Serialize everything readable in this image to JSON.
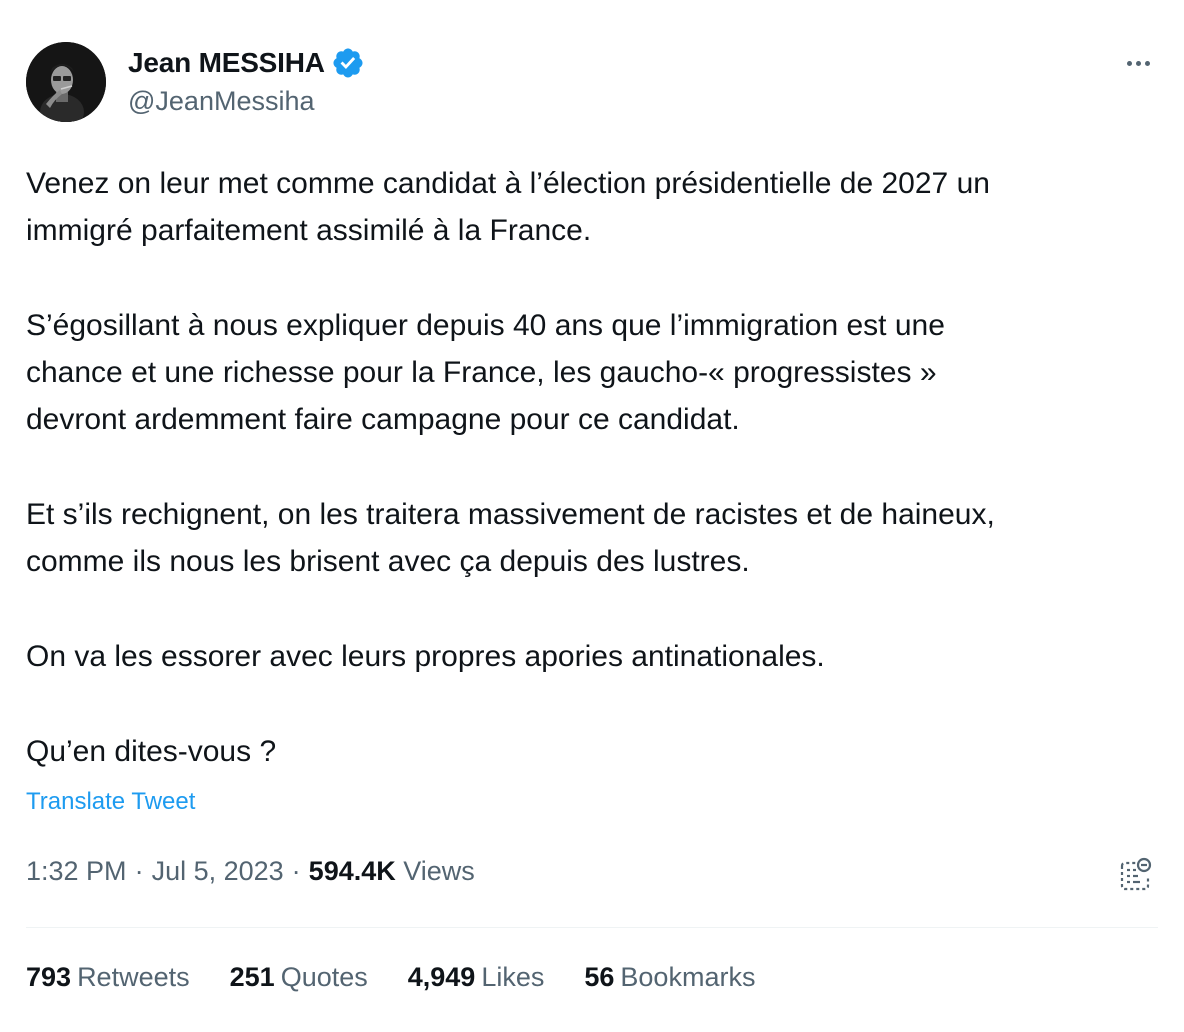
{
  "author": {
    "display_name": "Jean MESSIHA",
    "handle": "@JeanMessiha",
    "verified_icon": "verified-badge-icon",
    "verified_color": "#1d9bf0"
  },
  "more_icon": "more-horizontal-icon",
  "tweet": {
    "paragraphs": [
      "Venez on leur met comme candidat à l’élection présidentielle de 2027 un\nimmigré parfaitement assimilé à la France.",
      "S’égosillant à nous expliquer depuis 40 ans que l’immigration est une\nchance et une richesse pour la France, les gaucho-« progressistes »\ndevront ardemment faire campagne pour ce candidat.",
      "Et s’ils rechignent, on les traitera massivement de racistes et de haineux,\ncomme ils nous les brisent avec ça depuis des lustres.",
      "On va les essorer avec leurs propres apories antinationales.",
      "Qu’en dites-vous ?"
    ],
    "translate_label": "Translate Tweet"
  },
  "meta": {
    "time": "1:32 PM",
    "separator": "·",
    "date": "Jul 5, 2023",
    "views_count": "594.4K",
    "views_label": "Views"
  },
  "notes_icon": "community-notes-icon",
  "stats": [
    {
      "value": "793",
      "label": "Retweets"
    },
    {
      "value": "251",
      "label": "Quotes"
    },
    {
      "value": "4,949",
      "label": "Likes"
    },
    {
      "value": "56",
      "label": "Bookmarks"
    }
  ],
  "colors": {
    "text": "#0f1419",
    "secondary": "#536471",
    "link": "#1d9bf0",
    "divider": "#eff3f4"
  }
}
